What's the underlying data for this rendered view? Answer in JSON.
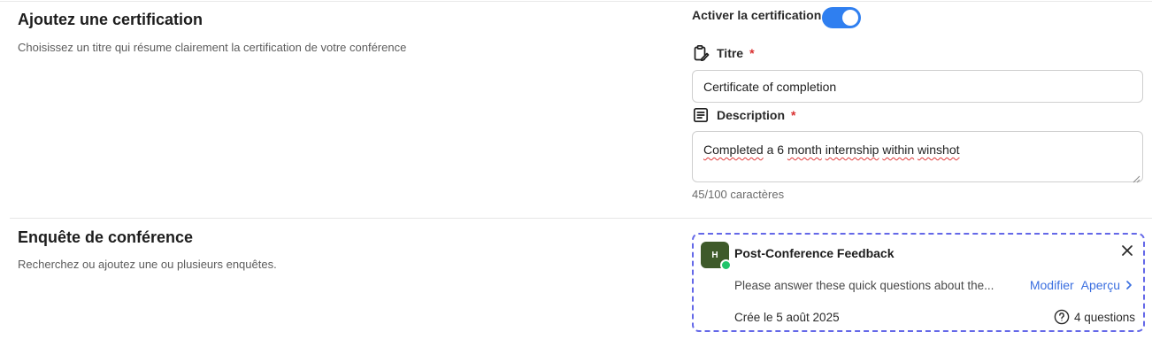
{
  "certification": {
    "title": "Ajoutez une certification",
    "description": "Choisissez un titre qui résume clairement la certification de votre conférence",
    "toggle_label": "Activer la certification",
    "toggle_on": true,
    "accent_color": "#2f7ff0",
    "title_field": {
      "label": "Titre",
      "required_mark": "*",
      "value": "Certificate of completion",
      "icon": "clipboard-edit-icon"
    },
    "description_field": {
      "label": "Description",
      "required_mark": "*",
      "value_parts": [
        "Completed",
        " a 6 ",
        "month",
        " ",
        "internship",
        " ",
        "within",
        " ",
        "winshot"
      ],
      "icon": "document-text-icon"
    },
    "counter": "45/100 caractères"
  },
  "survey_section": {
    "title": "Enquête de conférence",
    "description": "Recherchez ou ajoutez une ou plusieurs enquêtes.",
    "card": {
      "avatar_letter": "H",
      "avatar_color": "#3e5a2a",
      "status_color": "#21c46a",
      "border_color": "#6468e8",
      "title": "Post-Conference Feedback",
      "description": "Please answer these quick questions about the...",
      "modify_label": "Modifier",
      "preview_label": "Aperçu",
      "created": "Crée le 5 août 2025",
      "questions": "4 questions"
    }
  }
}
